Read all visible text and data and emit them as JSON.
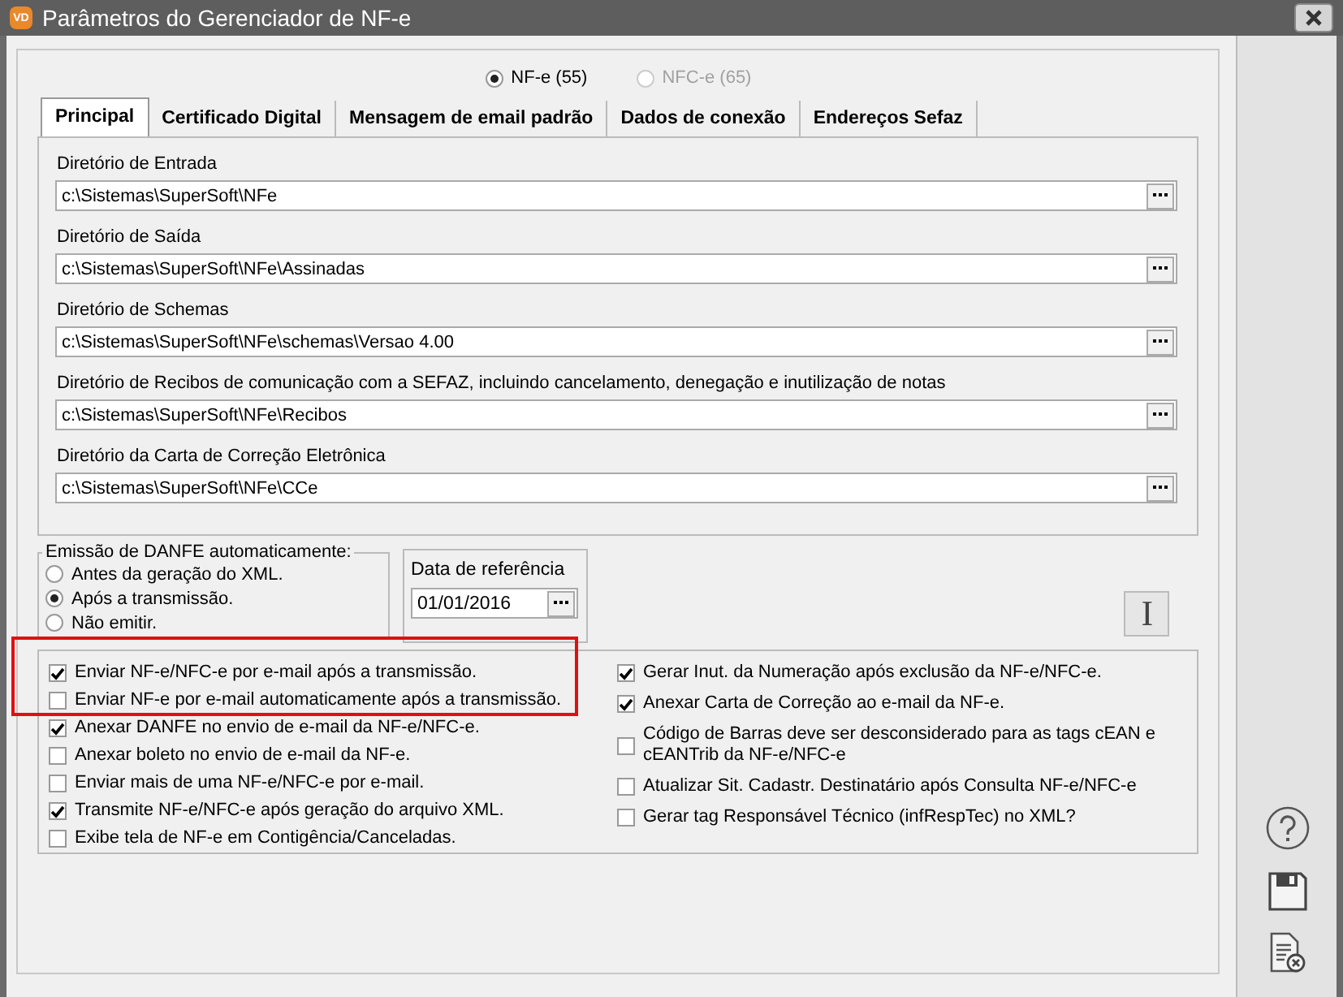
{
  "window": {
    "title": "Parâmetros do Gerenciador de NF-e",
    "logo": "VD"
  },
  "doc_types": [
    {
      "label": "NF-e (55)",
      "selected": true,
      "disabled": false
    },
    {
      "label": "NFC-e (65)",
      "selected": false,
      "disabled": true
    }
  ],
  "tabs": [
    {
      "label": "Principal",
      "selected": true
    },
    {
      "label": "Certificado Digital",
      "selected": false
    },
    {
      "label": "Mensagem de email padrão",
      "selected": false
    },
    {
      "label": "Dados de conexão",
      "selected": false
    },
    {
      "label": "Endereços Sefaz",
      "selected": false
    }
  ],
  "directories": [
    {
      "label": "Diretório de Entrada",
      "value": "c:\\Sistemas\\SuperSoft\\NFe"
    },
    {
      "label": "Diretório de Saída",
      "value": "c:\\Sistemas\\SuperSoft\\NFe\\Assinadas"
    },
    {
      "label": "Diretório de Schemas",
      "value": "c:\\Sistemas\\SuperSoft\\NFe\\schemas\\Versao 4.00"
    },
    {
      "label": "Diretório de Recibos de comunicação com a SEFAZ, incluindo cancelamento, denegação e inutilização de notas",
      "value": "c:\\Sistemas\\SuperSoft\\NFe\\Recibos"
    },
    {
      "label": "Diretório da Carta de Correção Eletrônica",
      "value": "c:\\Sistemas\\SuperSoft\\NFe\\CCe"
    }
  ],
  "danfe_group": {
    "title": "Emissão de DANFE automaticamente:",
    "options": [
      {
        "label": "Antes da geração do XML.",
        "selected": false
      },
      {
        "label": "Após a transmissão.",
        "selected": true
      },
      {
        "label": "Não emitir.",
        "selected": false
      }
    ]
  },
  "reference_date": {
    "label": "Data de referência",
    "value": "01/01/2016"
  },
  "info_button": "I",
  "options_left": [
    {
      "label": "Enviar NF-e/NFC-e por e-mail após a transmissão.",
      "checked": true
    },
    {
      "label": "Enviar NF-e por e-mail automaticamente após a transmissão.",
      "checked": false
    },
    {
      "label": "Anexar DANFE no envio de e-mail da NF-e/NFC-e.",
      "checked": true
    },
    {
      "label": "Anexar boleto no envio de e-mail da NF-e.",
      "checked": false
    },
    {
      "label": "Enviar mais de uma NF-e/NFC-e por e-mail.",
      "checked": false
    },
    {
      "label": "Transmite NF-e/NFC-e após geração do arquivo XML.",
      "checked": true
    },
    {
      "label": "Exibe tela de NF-e em Contigência/Canceladas.",
      "checked": false
    }
  ],
  "options_right": [
    {
      "label": "Gerar Inut. da Numeração após exclusão da NF-e/NFC-e.",
      "checked": true
    },
    {
      "label": "Anexar Carta de Correção ao e-mail da NF-e.",
      "checked": true
    },
    {
      "label": "Código de Barras deve ser desconsiderado para as tags cEAN e cEANTrib da NF-e/NFC-e",
      "checked": false
    },
    {
      "label": "Atualizar Sit. Cadastr. Destinatário após Consulta NF-e/NFC-e",
      "checked": false
    },
    {
      "label": "Gerar tag Responsável Técnico (infRespTec) no XML?",
      "checked": false
    }
  ]
}
